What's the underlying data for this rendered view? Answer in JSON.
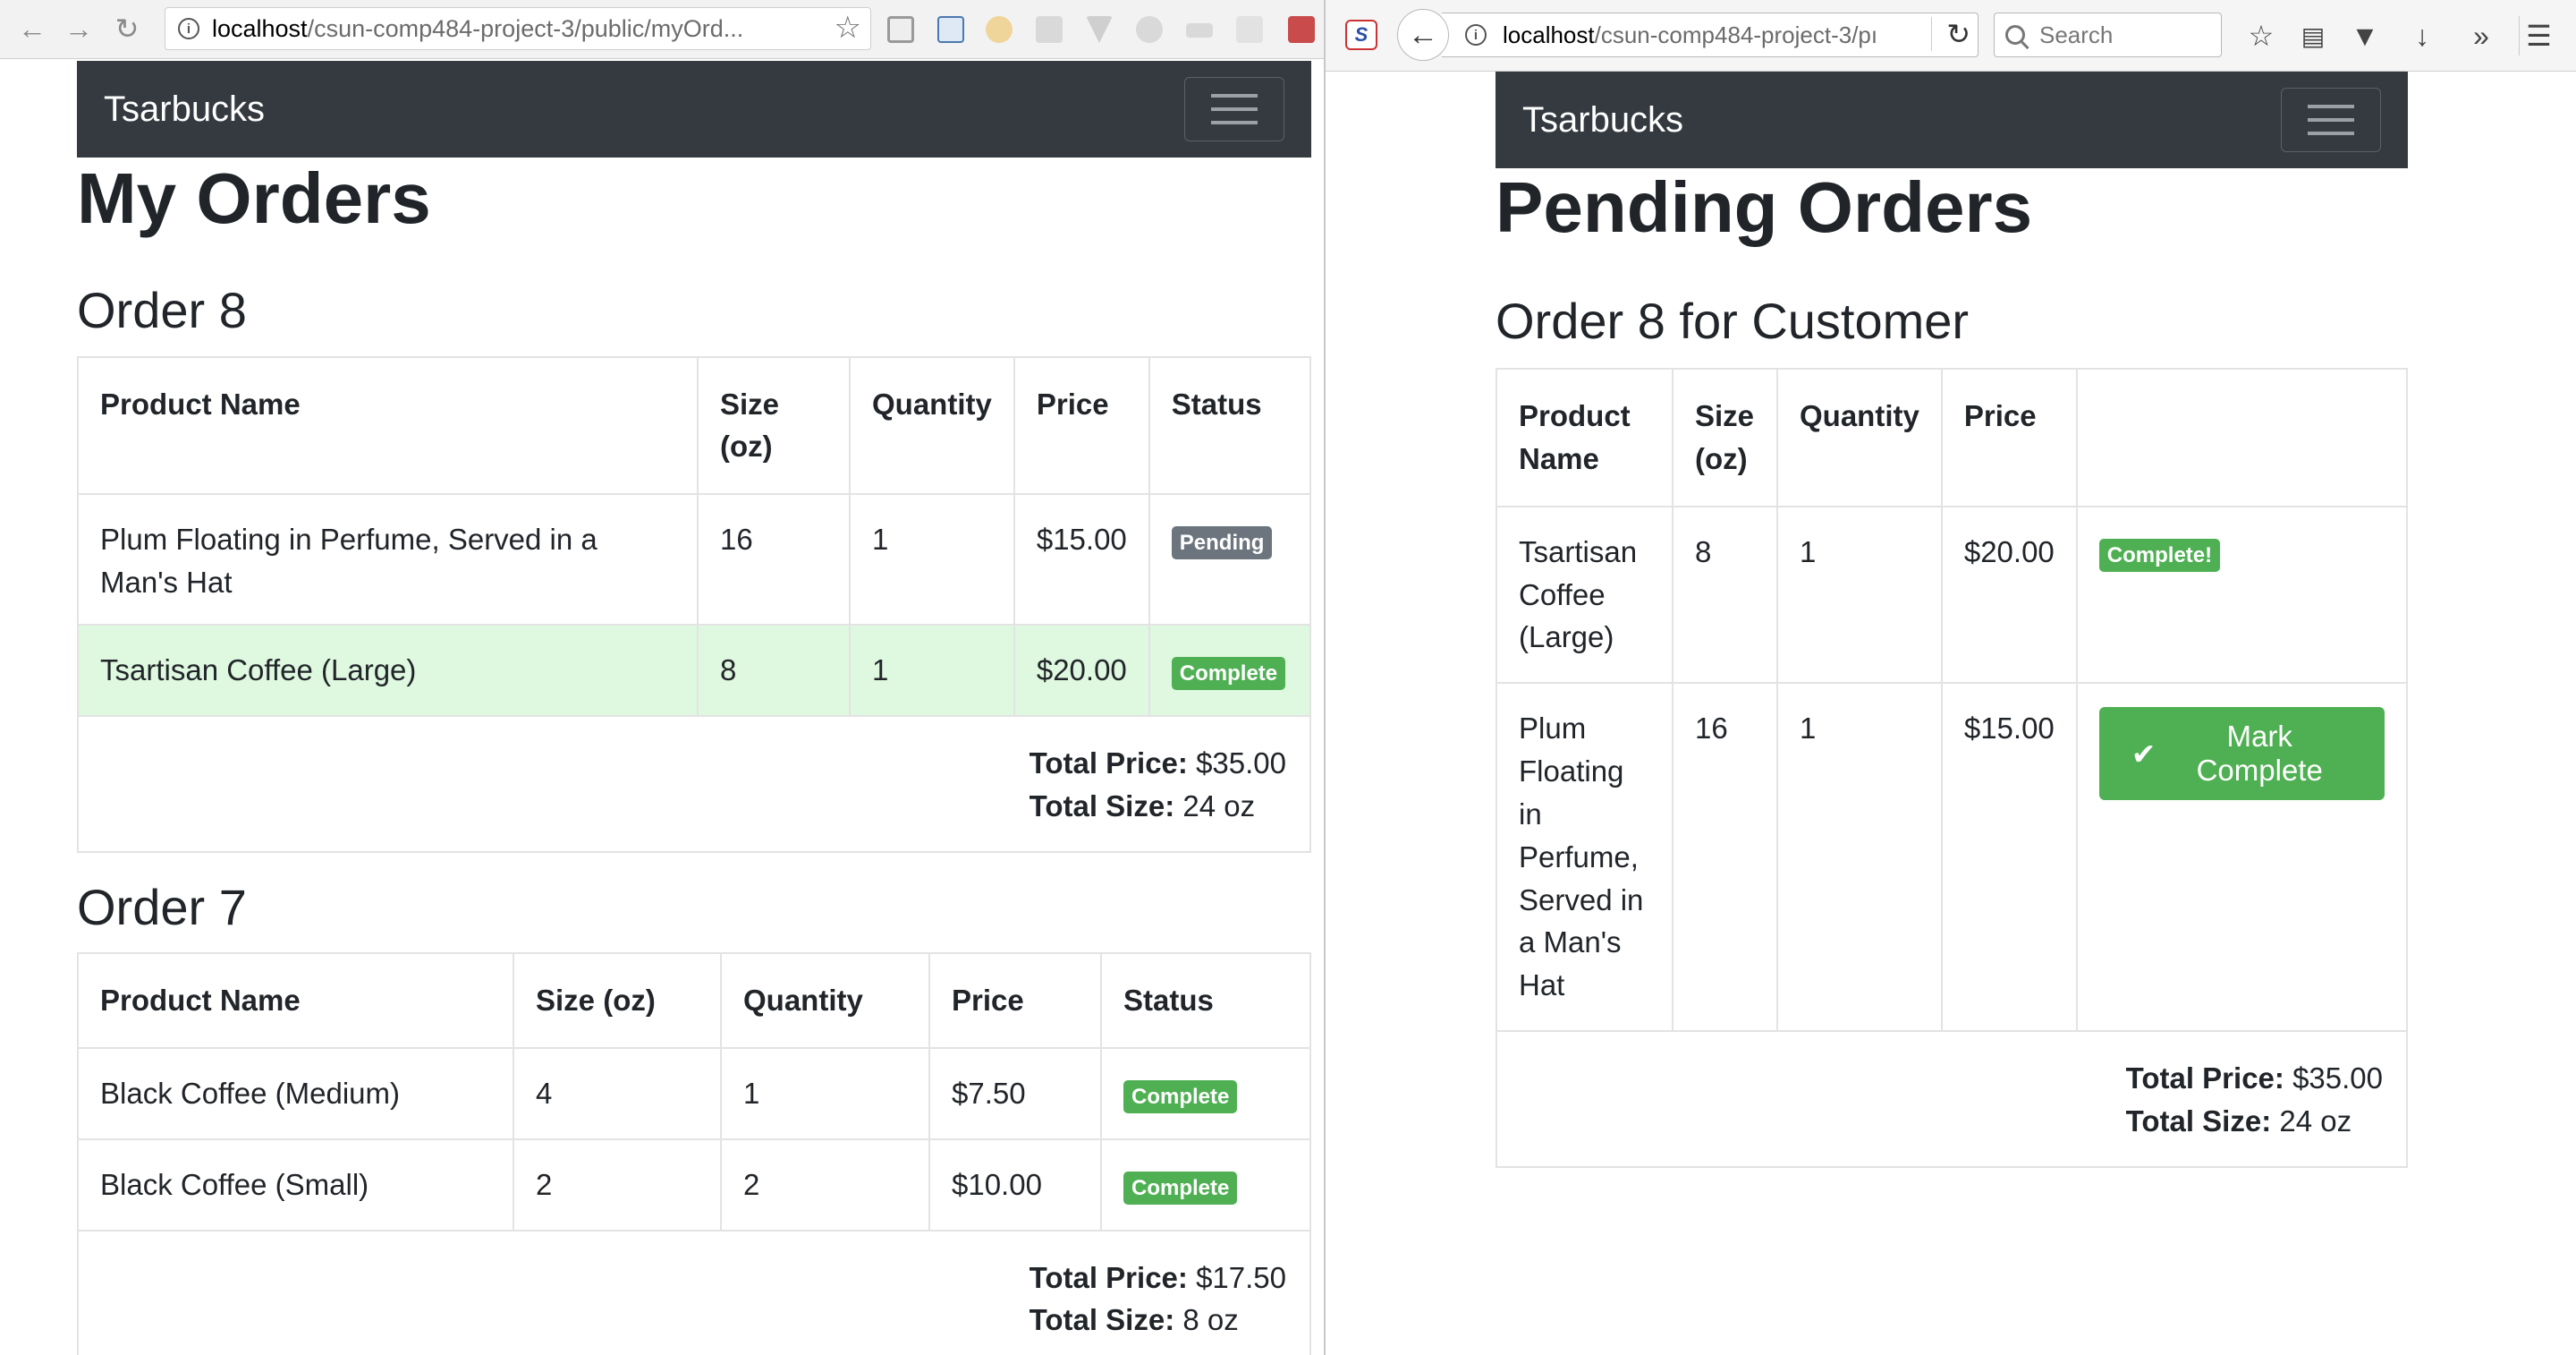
{
  "left_browser": {
    "url_host": "localhost",
    "url_path": "/csun-comp484-project-3/public/myOrd...",
    "icons": [
      "back-arrow-icon",
      "forward-arrow-icon",
      "reload-icon",
      "info-icon",
      "star-icon",
      "cast-icon",
      "extension-icon"
    ]
  },
  "right_browser": {
    "url_host": "localhost",
    "url_path": "/csun-comp484-project-3/pı",
    "search_placeholder": "Search",
    "icons": [
      "back-arrow-icon",
      "info-icon",
      "reload-icon",
      "search-icon",
      "star-icon",
      "reading-list-icon",
      "pocket-icon",
      "download-icon",
      "overflow-icon",
      "menu-icon"
    ]
  },
  "left_page": {
    "brand": "Tsarbucks",
    "title": "My Orders",
    "columns": [
      "Product Name",
      "Size (oz)",
      "Quantity",
      "Price",
      "Status"
    ],
    "orders": [
      {
        "heading": "Order 8",
        "items": [
          {
            "name": "Plum Floating in Perfume, Served in a Man's Hat",
            "size": "16",
            "quantity": "1",
            "price": "$15.00",
            "status": "Pending"
          },
          {
            "name": "Tsartisan Coffee (Large)",
            "size": "8",
            "quantity": "1",
            "price": "$20.00",
            "status": "Complete"
          }
        ],
        "total_price_label": "Total Price:",
        "total_price": "$35.00",
        "total_size_label": "Total Size:",
        "total_size": "24 oz"
      },
      {
        "heading": "Order 7",
        "items": [
          {
            "name": "Black Coffee (Medium)",
            "size": "4",
            "quantity": "1",
            "price": "$7.50",
            "status": "Complete"
          },
          {
            "name": "Black Coffee (Small)",
            "size": "2",
            "quantity": "2",
            "price": "$10.00",
            "status": "Complete"
          }
        ],
        "total_price_label": "Total Price:",
        "total_price": "$17.50",
        "total_size_label": "Total Size:",
        "total_size": "8 oz"
      }
    ]
  },
  "right_page": {
    "brand": "Tsarbucks",
    "title": "Pending Orders",
    "order_heading": "Order 8 for Customer",
    "columns": [
      "Product Name",
      "Size (oz)",
      "Quantity",
      "Price",
      ""
    ],
    "items": [
      {
        "name": "Tsartisan Coffee (Large)",
        "size": "8",
        "quantity": "1",
        "price": "$20.00",
        "status_badge": "Complete!"
      },
      {
        "name": "Plum Floating in Perfume, Served in a Man's Hat",
        "size": "16",
        "quantity": "1",
        "price": "$15.00",
        "action_label": "Mark Complete"
      }
    ],
    "total_price_label": "Total Price:",
    "total_price": "$35.00",
    "total_size_label": "Total Size:",
    "total_size": "24 oz"
  },
  "colors": {
    "navbar": "#343a40",
    "pending_badge": "#6c757d",
    "complete_badge": "#4fb053",
    "complete_row": "#dff8e0"
  }
}
